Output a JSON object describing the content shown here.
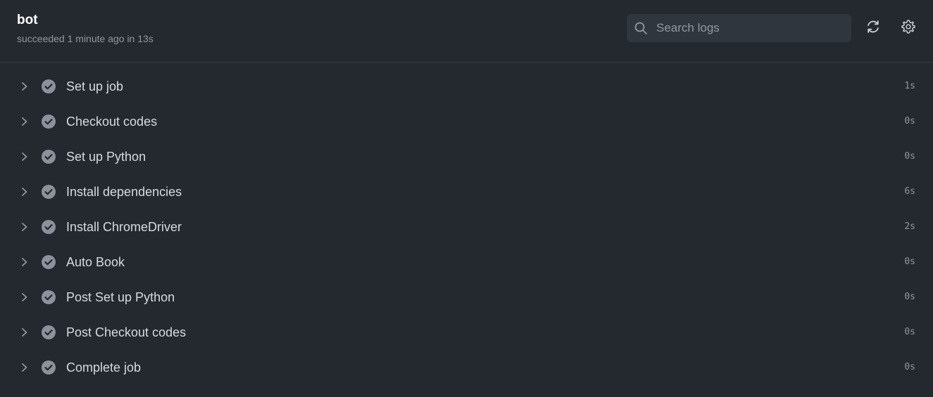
{
  "job": {
    "title": "bot",
    "status": "succeeded 1 minute ago in 13s"
  },
  "search": {
    "placeholder": "Search logs",
    "icon": "search-icon"
  },
  "toolbar": {
    "refresh_icon": "refresh-icon",
    "settings_icon": "gear-icon"
  },
  "colors": {
    "background": "#24282f",
    "check": "#8b929b",
    "muted": "#9198a1"
  },
  "steps": [
    {
      "name": "Set up job",
      "duration": "1s"
    },
    {
      "name": "Checkout codes",
      "duration": "0s"
    },
    {
      "name": "Set up Python",
      "duration": "0s"
    },
    {
      "name": "Install dependencies",
      "duration": "6s"
    },
    {
      "name": "Install ChromeDriver",
      "duration": "2s"
    },
    {
      "name": "Auto Book",
      "duration": "0s"
    },
    {
      "name": "Post Set up Python",
      "duration": "0s"
    },
    {
      "name": "Post Checkout codes",
      "duration": "0s"
    },
    {
      "name": "Complete job",
      "duration": "0s"
    }
  ]
}
